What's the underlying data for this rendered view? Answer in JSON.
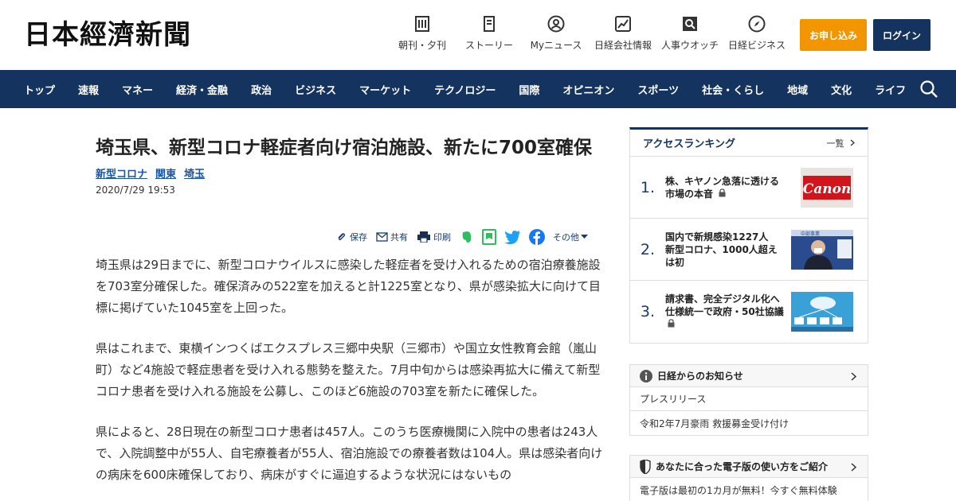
{
  "header": {
    "logo_text": "日本經濟新聞",
    "nav": [
      {
        "label": "朝刊・夕刊",
        "icon": "newspaper-icon"
      },
      {
        "label": "ストーリー",
        "icon": "story-icon"
      },
      {
        "label": "Myニュース",
        "icon": "user-icon"
      },
      {
        "label": "日経会社情報",
        "icon": "chart-icon"
      },
      {
        "label": "人事ウオッチ",
        "icon": "search-person-icon"
      },
      {
        "label": "日経ビジネス",
        "icon": "compass-icon"
      }
    ],
    "subscribe_label": "お申し込み",
    "login_label": "ログイン"
  },
  "global_nav": {
    "items": [
      "トップ",
      "速報",
      "マネー",
      "経済・金融",
      "政治",
      "ビジネス",
      "マーケット",
      "テクノロジー",
      "国際",
      "オピニオン",
      "スポーツ",
      "社会・くらし",
      "地域",
      "文化",
      "ライフ"
    ]
  },
  "article": {
    "title": "埼玉県、新型コロナ軽症者向け宿泊施設、新たに700室確保",
    "tags": [
      "新型コロナ",
      "関東",
      "埼玉"
    ],
    "date": "2020/7/29 19:53",
    "share": {
      "save": "保存",
      "share": "共有",
      "print": "印刷",
      "other": "その他"
    },
    "paragraphs": [
      "埼玉県は29日までに、新型コロナウイルスに感染した軽症者を受け入れるための宿泊療養施設を703室分確保した。確保済みの522室を加えると計1225室となり、県が感染拡大に向けて目標に掲げていた1045室を上回った。",
      "県はこれまで、東横インつくばエクスプレス三郷中央駅（三郷市）や国立女性教育会館（嵐山町）など4施設で軽症患者を受け入れる態勢を整えた。7月中旬からは感染再拡大に備えて新型コロナ患者を受け入れる施設を公募し、このほど6施設の703室を新たに確保した。",
      "県によると、28日現在の新型コロナ患者は457人。このうち医療機関に入院中の患者は243人で、入院調整中が55人、自宅療養者が55人、宿泊施設での療養者数は104人。県は感染者向けの病床を600床確保しており、病床がすぐに逼迫するような状況にはないもの"
    ]
  },
  "sidebar": {
    "ranking": {
      "title": "アクセスランキング",
      "more": "一覧",
      "items": [
        {
          "rank": "1.",
          "text": "株、キヤノン急落に透ける市場の本音",
          "locked": true,
          "thumb_text": "Canon"
        },
        {
          "rank": "2.",
          "text": "国内で新規感染1227人　新型コロナ、1000人超えは初",
          "locked": false,
          "thumb_text": "中部事業"
        },
        {
          "rank": "3.",
          "text": "請求書、完全デジタル化へ　仕様統一で政府・50社協議",
          "locked": true,
          "thumb_text": ""
        }
      ]
    },
    "notice": {
      "title": "日経からのお知らせ",
      "rows": [
        "プレスリリース",
        "令和2年7月豪雨 救援募金受け付け"
      ]
    },
    "guide": {
      "title": "あなたに合った電子版の使い方をご紹介",
      "rows": [
        "電子版は最初の1カ月が無料！今すぐ無料体験"
      ]
    }
  },
  "colors": {
    "navy": "#14335e",
    "orange": "#f29600",
    "link": "#1a56a0"
  }
}
